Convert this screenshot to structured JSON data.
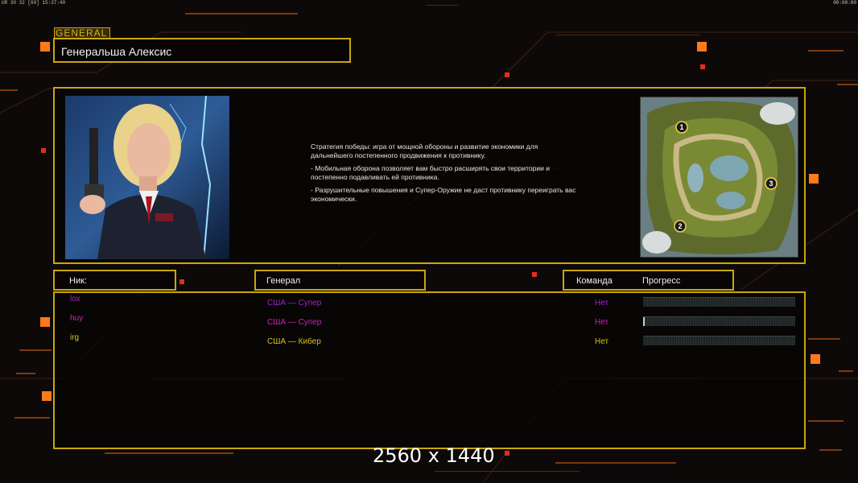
{
  "hud": {
    "top_left": "UR 30 32 [60] 15:37:40",
    "top_right": "00:00:00"
  },
  "section_tag": "GENERAL",
  "general_name": "Генеральша Алексис",
  "description": [
    "Стратегия победы: игра от мощной обороны и развитие экономики для дальнейшего постепенного продвижения к противнику.",
    "- Мобильная оборона позволяет вам быстро расширять свои территории и постепенно подавливать ей противника.",
    "- Разрушительные повышения и Супер-Оружие не даст противнику переиграть вас экономически."
  ],
  "map": {
    "markers": [
      "1",
      "2",
      "3"
    ]
  },
  "columns": {
    "nick": "Ник:",
    "general": "Генерал",
    "team": "Команда",
    "progress": "Прогресс"
  },
  "players": [
    {
      "nick": "lox",
      "general": "США — Супер",
      "team": "Нет",
      "progress": 0.0,
      "color": "#a020c8"
    },
    {
      "nick": "huy",
      "general": "США — Супер",
      "team": "Нет",
      "progress": 0.01,
      "color": "#d020b8"
    },
    {
      "nick": "irg",
      "general": "США — Кибер",
      "team": "Нет",
      "progress": 0.0,
      "color": "#d6c21a"
    }
  ],
  "watermark": "2560 x 1440",
  "colors": {
    "accent_gold": "#c9a70a",
    "accent_orange": "#ff7a1a",
    "background": "#0d0908"
  }
}
